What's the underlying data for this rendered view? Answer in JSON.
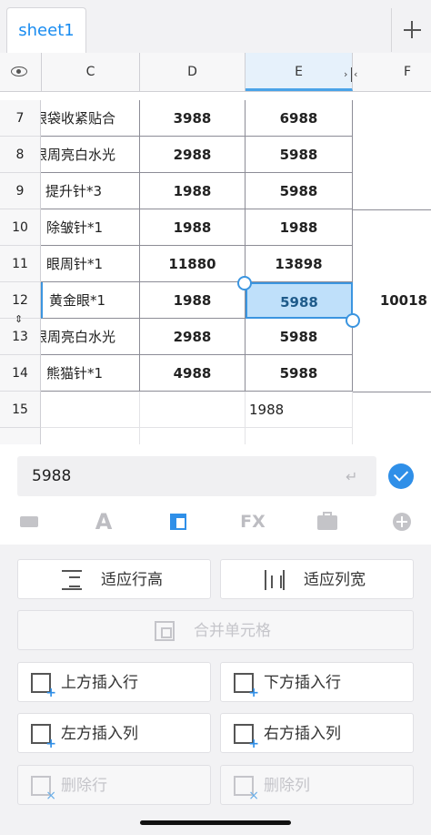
{
  "tabs": {
    "active": "sheet1"
  },
  "columns": [
    "C",
    "D",
    "E",
    "F"
  ],
  "rows": [
    {
      "n": "7",
      "c": "眼袋收紧贴合",
      "d": "3988",
      "e": "6988"
    },
    {
      "n": "8",
      "c": "眼周亮白水光",
      "d": "2988",
      "e": "5988"
    },
    {
      "n": "9",
      "c": "提升针*3",
      "d": "1988",
      "e": "5988"
    },
    {
      "n": "10",
      "c": "除皱针*1",
      "d": "1988",
      "e": "1988"
    },
    {
      "n": "11",
      "c": "眼周针*1",
      "d": "11880",
      "e": "13898"
    },
    {
      "n": "12",
      "c": "黄金眼*1",
      "d": "1988",
      "e": "5988",
      "f": "10018"
    },
    {
      "n": "13",
      "c": "眼周亮白水光",
      "d": "2988",
      "e": "5988"
    },
    {
      "n": "14",
      "c": "熊猫针*1",
      "d": "4988",
      "e": "5988"
    },
    {
      "n": "15",
      "c": "",
      "d": "",
      "e": "1988"
    }
  ],
  "editor": {
    "value": "5988"
  },
  "toolbar": {
    "font_glyph": "A",
    "fx_glyph": "FX"
  },
  "actions": {
    "fit_row_height": "适应行高",
    "fit_col_width": "适应列宽",
    "merge_cells": "合并单元格",
    "insert_row_above": "上方插入行",
    "insert_row_below": "下方插入行",
    "insert_col_left": "左方插入列",
    "insert_col_right": "右方插入列",
    "delete_row": "删除行",
    "delete_col": "删除列"
  },
  "colors": {
    "accent": "#2f8fe8",
    "selection": "#bfe0fa"
  }
}
